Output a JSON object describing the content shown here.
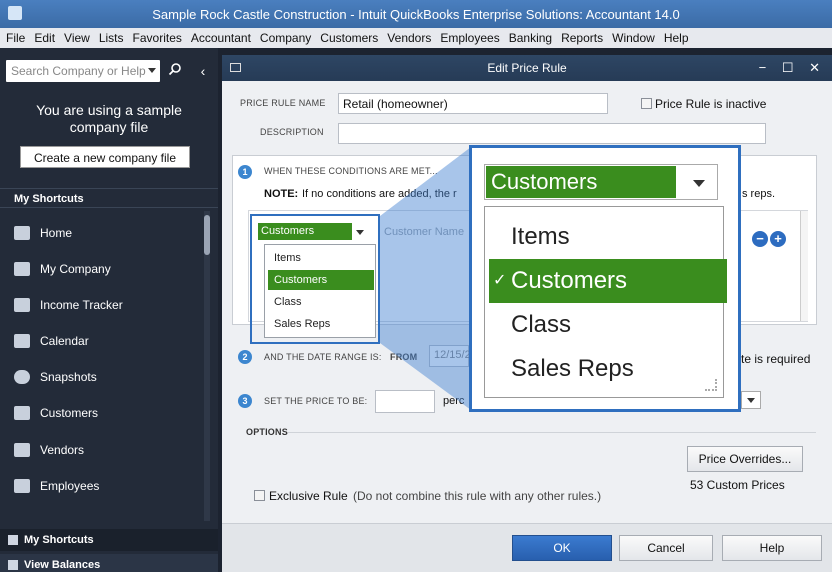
{
  "app": {
    "title": "Sample Rock Castle Construction  - Intuit QuickBooks Enterprise Solutions: Accountant 14.0"
  },
  "menu": [
    "File",
    "Edit",
    "View",
    "Lists",
    "Favorites",
    "Accountant",
    "Company",
    "Customers",
    "Vendors",
    "Employees",
    "Banking",
    "Reports",
    "Window",
    "Help"
  ],
  "sidebar": {
    "search_placeholder": "Search Company or Help",
    "notice": "You are using a sample company file",
    "create_button": "Create a new company file",
    "section_title": "My Shortcuts",
    "items": [
      {
        "label": "Home",
        "icon": "home-icon"
      },
      {
        "label": "My Company",
        "icon": "company-icon"
      },
      {
        "label": "Income Tracker",
        "icon": "income-tracker-icon"
      },
      {
        "label": "Calendar",
        "icon": "calendar-icon"
      },
      {
        "label": "Snapshots",
        "icon": "snapshots-icon"
      },
      {
        "label": "Customers",
        "icon": "customers-icon"
      },
      {
        "label": "Vendors",
        "icon": "vendors-icon"
      },
      {
        "label": "Employees",
        "icon": "employees-icon"
      }
    ],
    "bottom_tabs": [
      "My Shortcuts",
      "View Balances"
    ]
  },
  "dialog": {
    "title": "Edit Price Rule",
    "controls": "− ☐ ✕",
    "price_rule_name_label": "PRICE RULE NAME",
    "price_rule_name_value": "Retail  (homeowner)",
    "inactive_label": "Price Rule is inactive",
    "description_label": "DESCRIPTION",
    "step1_label": "WHEN THESE CONDITIONS ARE MET...",
    "note_prefix": "NOTE:",
    "note_text": "If no conditions are added, the r",
    "note_suffix": "s reps.",
    "condition_select": "Customers",
    "condition_field_placeholder": "Customer Name",
    "step2_label": "AND THE DATE RANGE IS:",
    "from_label": "FROM",
    "from_value": "12/15/2",
    "date_required_text": "te is required",
    "step3_label": "SET THE PRICE TO BE:",
    "price_unit_partial": "perc",
    "options_label": "OPTIONS",
    "price_overrides_button": "Price Overrides...",
    "custom_prices": "53 Custom Prices",
    "exclusive_rule_label": "Exclusive Rule",
    "exclusive_rule_note": "(Do not combine this rule with any other rules.)",
    "ok_button": "OK",
    "cancel_button": "Cancel",
    "help_button": "Help"
  },
  "dropdown": {
    "options": [
      "Items",
      "Customers",
      "Class",
      "Sales Reps"
    ],
    "selected": "Customers",
    "selected_index": 1,
    "checkmark": "✓"
  },
  "colors": {
    "select_green": "#3a8d1e",
    "highlight_blue": "#2f6fbf",
    "sidebar_bg": "#232b39"
  }
}
